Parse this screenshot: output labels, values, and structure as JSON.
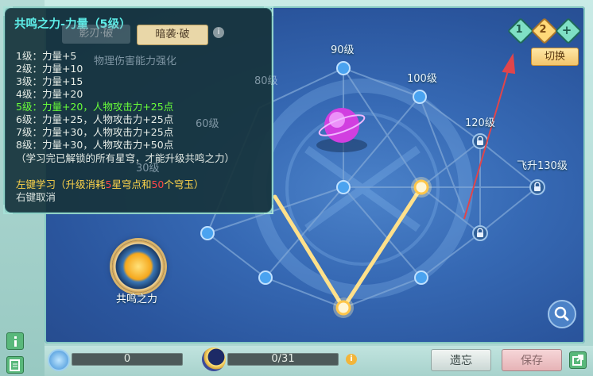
{
  "tooltip": {
    "title": "共鸣之力-力量（5级）",
    "lines": [
      "1级：力量+5",
      "2级：力量+10",
      "3级：力量+15",
      "4级：力量+20",
      "5级：力量+20，人物攻击力+25点",
      "6级：力量+25，人物攻击力+25点",
      "7级：力量+30，人物攻击力+25点",
      "8级：力量+30，人物攻击力+50点",
      "（学习完已解锁的所有星穹，才能升级共鸣之力）"
    ],
    "learn_prefix": "左键学习（升级消耗",
    "learn_star_count": "5",
    "learn_mid": "星穹点和",
    "learn_jade_count": "50",
    "learn_suffix": "个穹玉）",
    "cancel": "右键取消"
  },
  "background_tabs": {
    "tab1": "影刃·破",
    "tab2": "暗袭·破",
    "subtitle": "物理伤害能力强化"
  },
  "nodes": {
    "lv90": "90级",
    "lv100": "100级",
    "lv120": "120级",
    "lv_ascend130": "飞升130级",
    "ghost_80": "80级",
    "ghost_60": "60级",
    "ghost_30": "30级"
  },
  "resonance_label": "共鸣之力",
  "pager": {
    "p1": "1",
    "p2": "2",
    "add": "+"
  },
  "switch_label": "切换",
  "bottom": {
    "star_points": "0",
    "jade_progress": "0/31",
    "forget_label": "遗忘",
    "save_label": "保存"
  },
  "colors": {
    "accent": "#5ef0ea",
    "green": "#69ff3a",
    "yellow": "#ffd54a",
    "red": "#ff4747",
    "arrow": "#e0454b"
  },
  "icons": [
    "info-icon",
    "edit-icon",
    "lock-icon",
    "search-icon",
    "share-icon",
    "star-point-icon",
    "moon-jade-icon",
    "help-icon"
  ]
}
